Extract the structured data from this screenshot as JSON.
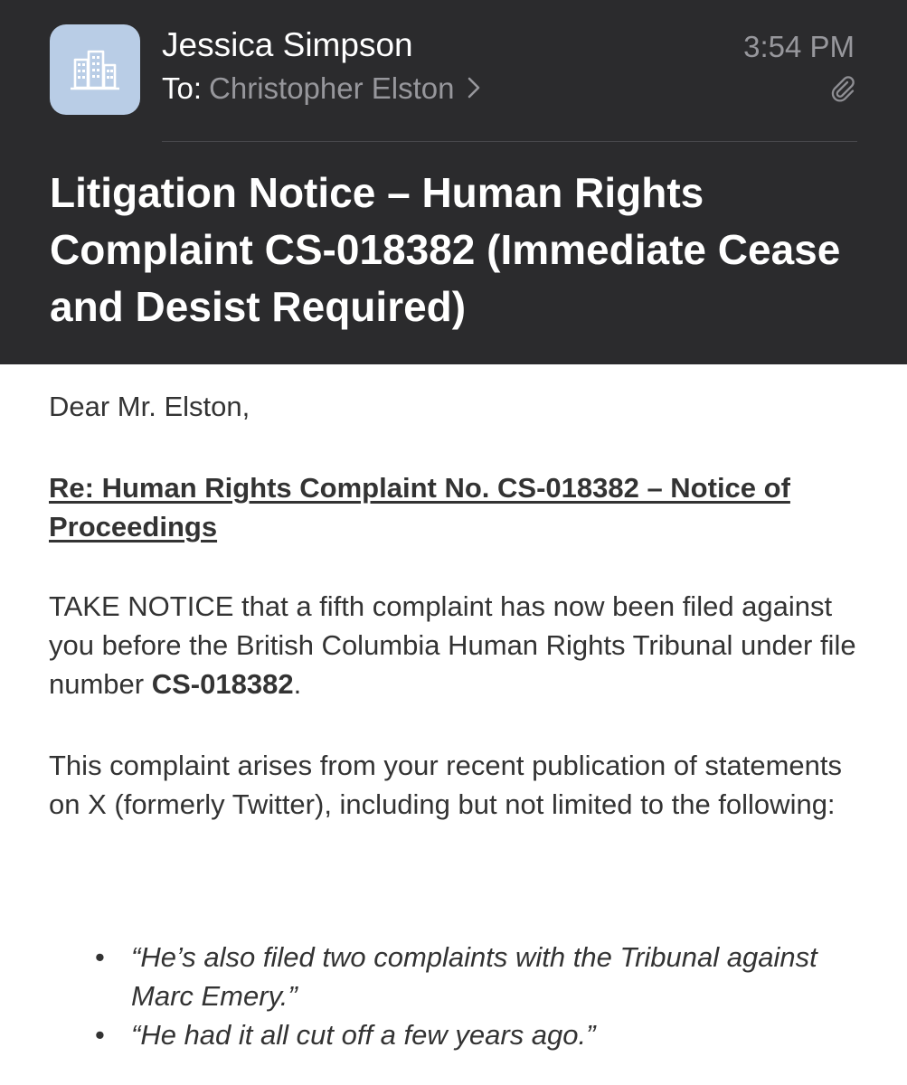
{
  "header": {
    "sender": "Jessica Simpson",
    "to_label": "To:",
    "recipient": "Christopher Elston",
    "time": "3:54 PM",
    "avatar_icon": "building-icon",
    "attachment_icon": "paperclip-icon",
    "subject": "Litigation Notice – Human Rights Complaint CS-018382 (Immediate Cease and Desist Required)"
  },
  "body": {
    "greeting": "Dear Mr. Elston,",
    "re_line": "Re: Human Rights Complaint No. CS-018382 – Notice of Proceedings",
    "p1_text": "TAKE NOTICE that a fifth complaint has now been filed against you before the British Columbia Human Rights Tribunal under file number ",
    "p1_file": "CS-018382",
    "p1_end": ".",
    "p2": "This complaint arises from your recent publication of statements on X (formerly Twitter), including but not limited to the following:",
    "quotes": [
      "“He’s also filed two complaints with the Tribunal against Marc Emery.”",
      "“He had it all cut off a few years ago.”"
    ]
  },
  "colors": {
    "header_bg": "#2b2b2d",
    "avatar_bg": "#b9cde6",
    "muted_text": "#97979c",
    "body_text": "#333333"
  }
}
